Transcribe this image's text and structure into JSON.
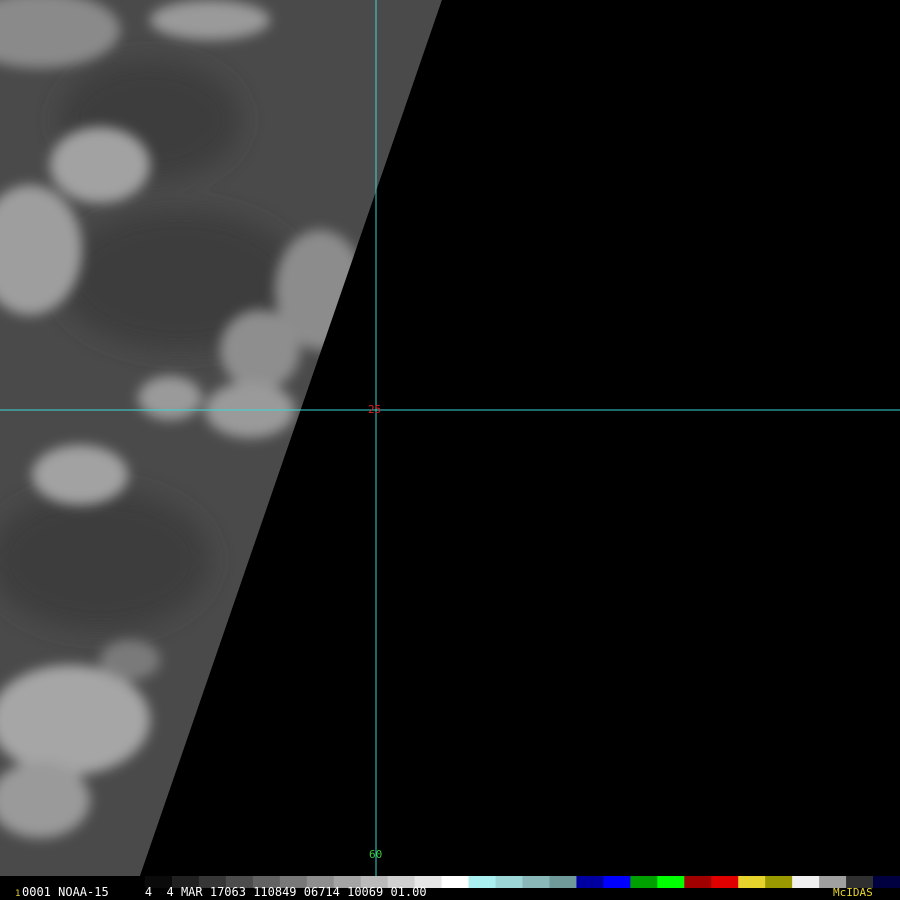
{
  "image": {
    "background_color": "#000000",
    "swath_color": "#4a4a4a",
    "cloud_color": "#9a9a9a",
    "grid_color": "#39d6d6"
  },
  "grid_labels": {
    "latitude_label": "25",
    "latitude_label_color": "#d42020",
    "longitude_label": "60",
    "longitude_label_color": "#3ec83e"
  },
  "status_bar": {
    "frame_index": "1",
    "frame_index_color": "#e6d32b",
    "info": "0001 NOAA-15     4  4 MAR 17063 110849 06714 10069 01.00",
    "info_color": "#ffffff",
    "brand": "McIDAS",
    "brand_color": "#e6d32b"
  },
  "color_table": [
    "#0a0a0a",
    "#202020",
    "#363636",
    "#4c4c4c",
    "#626262",
    "#787878",
    "#8e8e8e",
    "#a4a4a4",
    "#bababa",
    "#d0d0d0",
    "#e6e6e6",
    "#ffffff",
    "#aaf0f0",
    "#9cd6d6",
    "#8ab8b8",
    "#709a9a",
    "#0000a0",
    "#0000ff",
    "#00a000",
    "#00ff00",
    "#a00000",
    "#e00000",
    "#e6d32b",
    "#9a9a00",
    "#f0f0f0",
    "#a0a0a0",
    "#303030",
    "#000040"
  ]
}
